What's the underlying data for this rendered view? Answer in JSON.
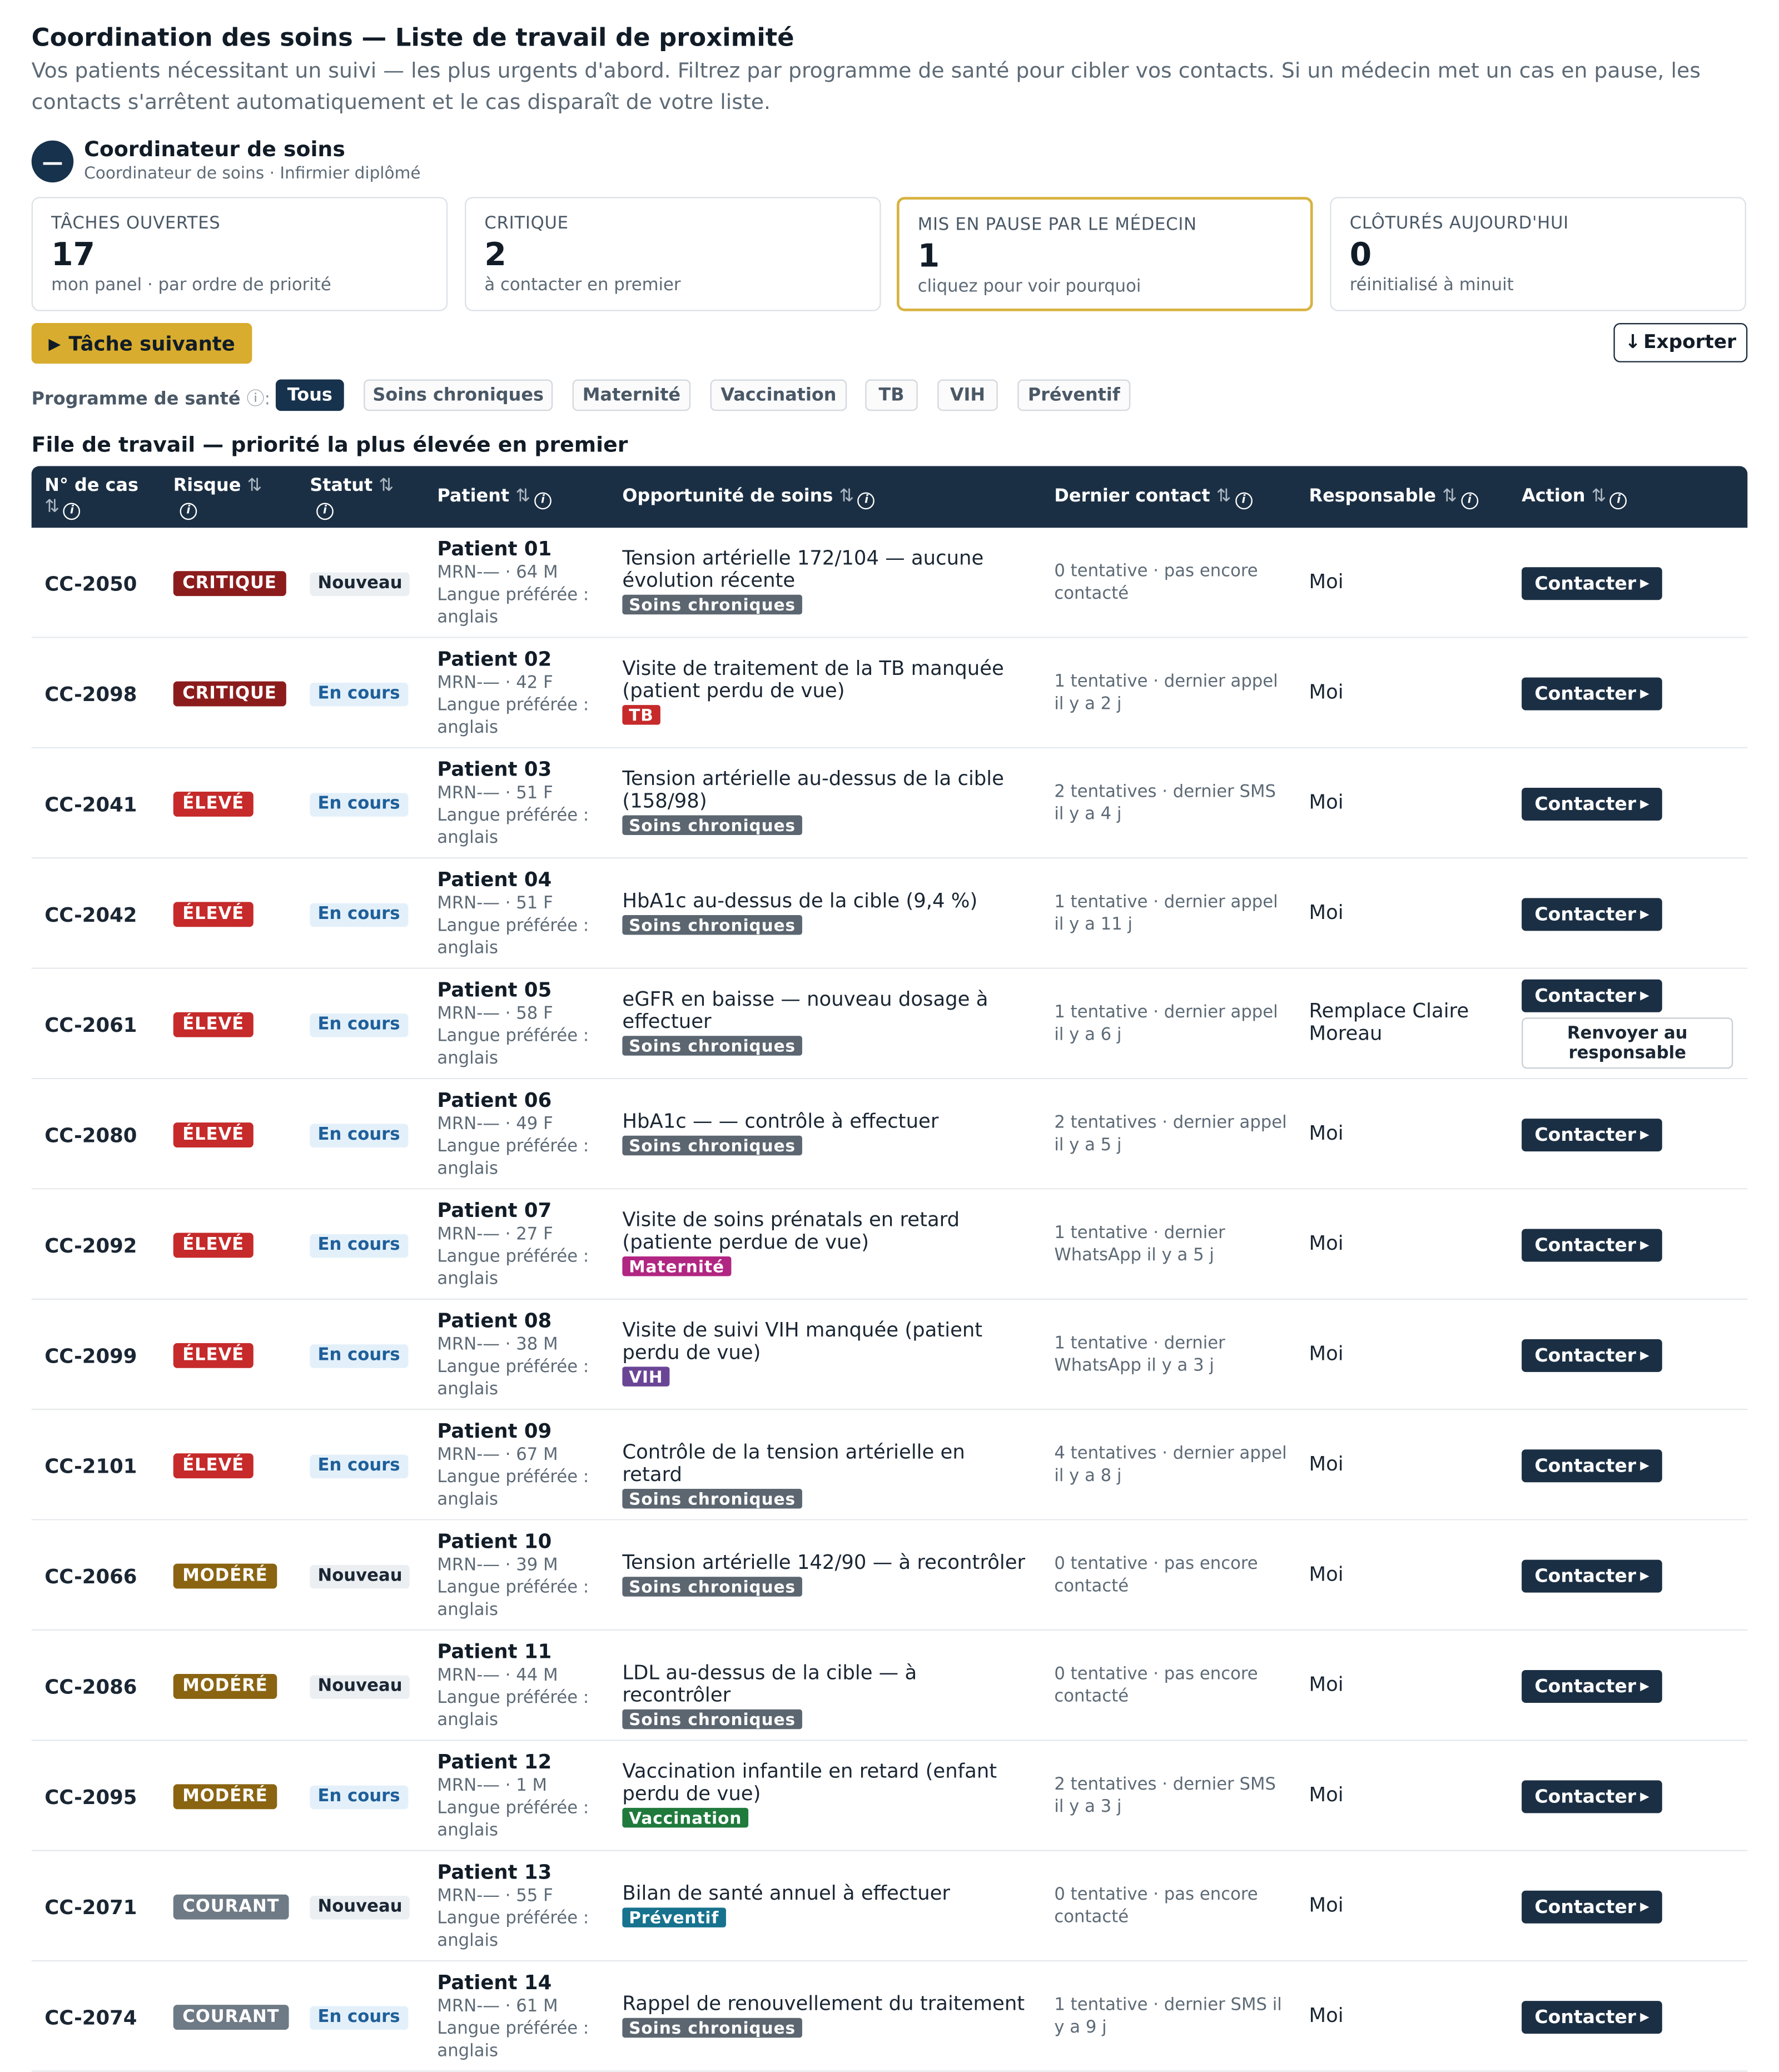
{
  "header": {
    "title": "Coordination des soins — Liste de travail de proximité",
    "description": "Vos patients nécessitant un suivi — les plus urgents d'abord. Filtrez par programme de santé pour cibler vos contacts. Si un médecin met un cas en pause, les contacts s'arrêtent automatiquement et le cas disparaît de votre liste."
  },
  "user": {
    "avatar_glyph": "—",
    "name": "Coordinateur de soins",
    "role": "Coordinateur de soins · Infirmier diplômé"
  },
  "stats": [
    {
      "label": "TÂCHES OUVERTES",
      "value": "17",
      "sub": "mon panel · par ordre de priorité"
    },
    {
      "label": "CRITIQUE",
      "value": "2",
      "sub": "à contacter en premier"
    },
    {
      "label": "MIS EN PAUSE PAR LE MÉDECIN",
      "value": "1",
      "sub": "cliquez pour voir pourquoi"
    },
    {
      "label": "CLÔTURÉS AUJOURD'HUI",
      "value": "0",
      "sub": "réinitialisé à minuit"
    }
  ],
  "actions": {
    "next_task": "Tâche suivante",
    "export": "Exporter"
  },
  "filters": {
    "label": "Programme de santé",
    "chips": [
      "Tous",
      "Soins chroniques",
      "Maternité",
      "Vaccination",
      "TB",
      "VIH",
      "Préventif"
    ],
    "active": "Tous"
  },
  "section_title": "File de travail — priorité la plus élevée en premier",
  "columns": {
    "case": "N° de cas",
    "risk": "Risque",
    "status": "Statut",
    "patient": "Patient",
    "opportunity": "Opportunité de soins",
    "last_contact": "Dernier contact",
    "owner": "Responsable",
    "action": "Action"
  },
  "colors": {
    "critique": "#8c1c1c",
    "eleve": "#c62a2a",
    "modere": "#8a6411",
    "courant": "#6e7a85",
    "chroniques": "#5c6670",
    "tb": "#c62a2a",
    "maternite": "#b12682",
    "vih": "#6a4596",
    "vaccination": "#1f7a3c",
    "preventif": "#17728e"
  },
  "rows": [
    {
      "case": "CC-2050",
      "risk": "CRITIQUE",
      "risk_color": "critique",
      "status": "Nouveau",
      "status_kind": "new",
      "patient": "Patient 01",
      "meta": "MRN-— · 64 M",
      "lang": "Langue préférée : anglais",
      "opp": "Tension artérielle 172/104 — aucune évolution récente",
      "program": "Soins chroniques",
      "program_color": "chroniques",
      "contact": "0 tentative · pas encore contacté",
      "owner": "Moi",
      "action": "Contacter"
    },
    {
      "case": "CC-2098",
      "risk": "CRITIQUE",
      "risk_color": "critique",
      "status": "En cours",
      "status_kind": "prog",
      "patient": "Patient 02",
      "meta": "MRN-— · 42 F",
      "lang": "Langue préférée : anglais",
      "opp": "Visite de traitement de la TB manquée (patient perdu de vue)",
      "program": "TB",
      "program_color": "tb",
      "contact": "1 tentative · dernier appel il y a 2 j",
      "owner": "Moi",
      "action": "Contacter"
    },
    {
      "case": "CC-2041",
      "risk": "ÉLEVÉ",
      "risk_color": "eleve",
      "status": "En cours",
      "status_kind": "prog",
      "patient": "Patient 03",
      "meta": "MRN-— · 51 F",
      "lang": "Langue préférée : anglais",
      "opp": "Tension artérielle au-dessus de la cible (158/98)",
      "program": "Soins chroniques",
      "program_color": "chroniques",
      "contact": "2 tentatives · dernier SMS il y a 4 j",
      "owner": "Moi",
      "action": "Contacter"
    },
    {
      "case": "CC-2042",
      "risk": "ÉLEVÉ",
      "risk_color": "eleve",
      "status": "En cours",
      "status_kind": "prog",
      "patient": "Patient 04",
      "meta": "MRN-— · 51 F",
      "lang": "Langue préférée : anglais",
      "opp": "HbA1c au-dessus de la cible (9,4 %)",
      "program": "Soins chroniques",
      "program_color": "chroniques",
      "contact": "1 tentative · dernier appel il y a 11 j",
      "owner": "Moi",
      "action": "Contacter"
    },
    {
      "case": "CC-2061",
      "risk": "ÉLEVÉ",
      "risk_color": "eleve",
      "status": "En cours",
      "status_kind": "prog",
      "patient": "Patient 05",
      "meta": "MRN-— · 58 F",
      "lang": "Langue préférée : anglais",
      "opp": "eGFR en baisse — nouveau dosage à effectuer",
      "program": "Soins chroniques",
      "program_color": "chroniques",
      "contact": "1 tentative · dernier appel il y a 6 j",
      "owner": "Remplace Claire Moreau",
      "action": "Contacter",
      "secondary_action": "Renvoyer au responsable"
    },
    {
      "case": "CC-2080",
      "risk": "ÉLEVÉ",
      "risk_color": "eleve",
      "status": "En cours",
      "status_kind": "prog",
      "patient": "Patient 06",
      "meta": "MRN-— · 49 F",
      "lang": "Langue préférée : anglais",
      "opp": "HbA1c — — contrôle à effectuer",
      "program": "Soins chroniques",
      "program_color": "chroniques",
      "contact": "2 tentatives · dernier appel il y a 5 j",
      "owner": "Moi",
      "action": "Contacter"
    },
    {
      "case": "CC-2092",
      "risk": "ÉLEVÉ",
      "risk_color": "eleve",
      "status": "En cours",
      "status_kind": "prog",
      "patient": "Patient 07",
      "meta": "MRN-— · 27 F",
      "lang": "Langue préférée : anglais",
      "opp": "Visite de soins prénatals en retard (patiente perdue de vue)",
      "program": "Maternité",
      "program_color": "maternite",
      "contact": "1 tentative · dernier WhatsApp il y a 5 j",
      "owner": "Moi",
      "action": "Contacter"
    },
    {
      "case": "CC-2099",
      "risk": "ÉLEVÉ",
      "risk_color": "eleve",
      "status": "En cours",
      "status_kind": "prog",
      "patient": "Patient 08",
      "meta": "MRN-— · 38 M",
      "lang": "Langue préférée : anglais",
      "opp": "Visite de suivi VIH manquée (patient perdu de vue)",
      "program": "VIH",
      "program_color": "vih",
      "contact": "1 tentative · dernier WhatsApp il y a 3 j",
      "owner": "Moi",
      "action": "Contacter"
    },
    {
      "case": "CC-2101",
      "risk": "ÉLEVÉ",
      "risk_color": "eleve",
      "status": "En cours",
      "status_kind": "prog",
      "patient": "Patient 09",
      "meta": "MRN-— · 67 M",
      "lang": "Langue préférée : anglais",
      "opp": "Contrôle de la tension artérielle en retard",
      "program": "Soins chroniques",
      "program_color": "chroniques",
      "contact": "4 tentatives · dernier appel il y a 8 j",
      "owner": "Moi",
      "action": "Contacter"
    },
    {
      "case": "CC-2066",
      "risk": "MODÉRÉ",
      "risk_color": "modere",
      "status": "Nouveau",
      "status_kind": "new",
      "patient": "Patient 10",
      "meta": "MRN-— · 39 M",
      "lang": "Langue préférée : anglais",
      "opp": "Tension artérielle 142/90 — à recontrôler",
      "program": "Soins chroniques",
      "program_color": "chroniques",
      "contact": "0 tentative · pas encore contacté",
      "owner": "Moi",
      "action": "Contacter"
    },
    {
      "case": "CC-2086",
      "risk": "MODÉRÉ",
      "risk_color": "modere",
      "status": "Nouveau",
      "status_kind": "new",
      "patient": "Patient 11",
      "meta": "MRN-— · 44 M",
      "lang": "Langue préférée : anglais",
      "opp": "LDL au-dessus de la cible — à recontrôler",
      "program": "Soins chroniques",
      "program_color": "chroniques",
      "contact": "0 tentative · pas encore contacté",
      "owner": "Moi",
      "action": "Contacter"
    },
    {
      "case": "CC-2095",
      "risk": "MODÉRÉ",
      "risk_color": "modere",
      "status": "En cours",
      "status_kind": "prog",
      "patient": "Patient 12",
      "meta": "MRN-— · 1 M",
      "lang": "Langue préférée : anglais",
      "opp": "Vaccination infantile en retard (enfant perdu de vue)",
      "program": "Vaccination",
      "program_color": "vaccination",
      "contact": "2 tentatives · dernier SMS il y a 3 j",
      "owner": "Moi",
      "action": "Contacter"
    },
    {
      "case": "CC-2071",
      "risk": "COURANT",
      "risk_color": "courant",
      "status": "Nouveau",
      "status_kind": "new",
      "patient": "Patient 13",
      "meta": "MRN-— · 55 F",
      "lang": "Langue préférée : anglais",
      "opp": "Bilan de santé annuel à effectuer",
      "program": "Préventif",
      "program_color": "preventif",
      "contact": "0 tentative · pas encore contacté",
      "owner": "Moi",
      "action": "Contacter"
    },
    {
      "case": "CC-2074",
      "risk": "COURANT",
      "risk_color": "courant",
      "status": "En cours",
      "status_kind": "prog",
      "patient": "Patient 14",
      "meta": "MRN-— · 61 M",
      "lang": "Langue préférée : anglais",
      "opp": "Rappel de renouvellement du traitement",
      "program": "Soins chroniques",
      "program_color": "chroniques",
      "contact": "1 tentative · dernier SMS il y a 9 j",
      "owner": "Moi",
      "action": "Contacter"
    }
  ]
}
